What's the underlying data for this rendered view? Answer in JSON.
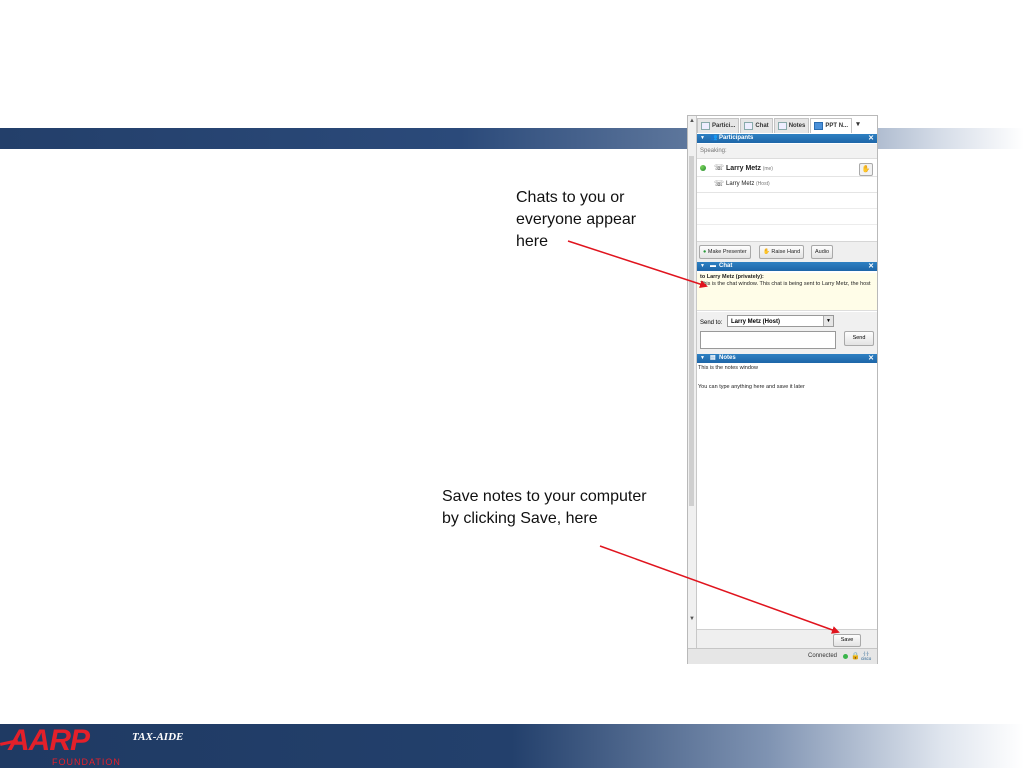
{
  "slide": {
    "footer_brand": "AARP",
    "footer_foundation": "FOUNDATION",
    "footer_program": "TAX-AIDE",
    "brand_color": "#e4202a",
    "band_color": "#23406c"
  },
  "callouts": {
    "chat": [
      "Chats to you or",
      "everyone appear",
      "here"
    ],
    "save": [
      "Save notes to your computer",
      "by clicking Save, here"
    ],
    "arrow_color": "#e0141e"
  },
  "webex": {
    "tabs": [
      {
        "label": "Partici...",
        "icon": "participants-icon"
      },
      {
        "label": "Chat",
        "icon": "chat-icon"
      },
      {
        "label": "Notes",
        "icon": "notes-icon"
      },
      {
        "label": "PPT N...",
        "icon": "ppt-icon"
      }
    ],
    "participants": {
      "header": "Participants",
      "speaking_label": "Speaking:",
      "rows": [
        {
          "name": "Larry Metz",
          "tag": "(me)"
        },
        {
          "name": "Larry Metz",
          "tag": "(Host)"
        }
      ],
      "buttons": {
        "make_presenter": "Make Presenter",
        "raise_hand": "Raise Hand",
        "audio": "Audio"
      }
    },
    "chat": {
      "header": "Chat",
      "to_line": "to Larry Metz (privately):",
      "message": "This is the chat window.  This chat is being sent to Larry Metz, the host",
      "send_to_label": "Send to:",
      "send_to_value": "Larry Metz (Host)",
      "send_button": "Send"
    },
    "notes": {
      "header": "Notes",
      "line1": "This is the notes window",
      "line2": "You can type anything here and save it later",
      "save_button": "Save"
    },
    "status": {
      "connected": "Connected",
      "brand": "cisco"
    },
    "header_color": "#1e66a8"
  }
}
